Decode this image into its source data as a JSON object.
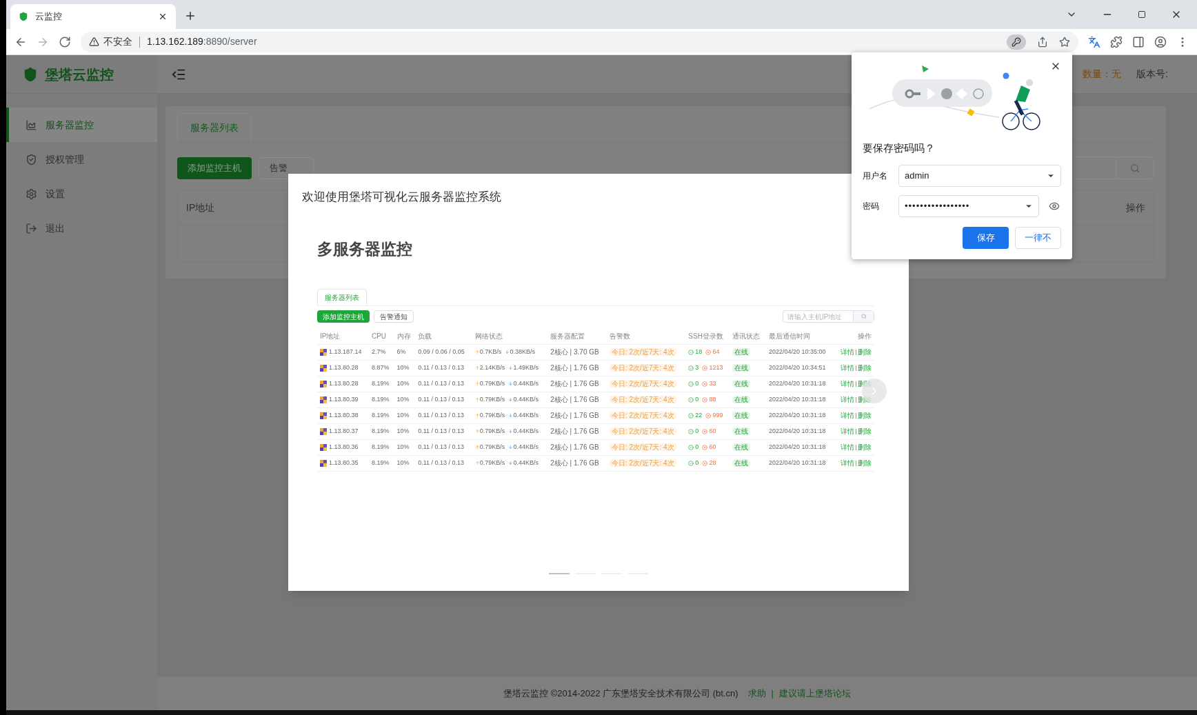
{
  "browser": {
    "tab": {
      "title": "云监控"
    },
    "address": {
      "security": "不安全",
      "host": "1.13.162.189",
      "path": ":8890/server"
    }
  },
  "app": {
    "logo": "堡塔云监控",
    "header_info": [
      {
        "text": "数量：无"
      },
      {
        "text": "版本号:"
      }
    ],
    "sidebar": [
      {
        "label": "服务器监控",
        "selected": true
      },
      {
        "label": "授权管理",
        "selected": false
      },
      {
        "label": "设置",
        "selected": false
      },
      {
        "label": "退出",
        "selected": false
      }
    ],
    "tabs": [
      {
        "label": "服务器列表",
        "selected": true
      }
    ],
    "buttons": [
      {
        "label": "添加监控主机",
        "kind": "primary"
      },
      {
        "label": "告警",
        "kind": "default"
      }
    ],
    "table": {
      "columns": [
        "IP地址",
        "操作"
      ]
    },
    "footer": {
      "text": "堡塔云监控 ©2014-2022 广东堡塔安全技术有限公司 (bt.cn)",
      "links": [
        "求助",
        "建议请上堡塔论坛"
      ],
      "separator": "|"
    }
  },
  "modal": {
    "title": "欢迎使用堡塔可视化云服务器监控系统",
    "heading": "多服务器监控",
    "indicators": [
      {
        "selected": true
      },
      {
        "selected": false
      },
      {
        "selected": false
      },
      {
        "selected": false
      }
    ],
    "preview": {
      "tabs": [
        {
          "label": "服务器列表",
          "selected": true
        }
      ],
      "buttons": [
        {
          "label": "添加监控主机",
          "kind": "primary"
        },
        {
          "label": "告警通知",
          "kind": "default"
        }
      ],
      "search": {
        "placeholder": "请输入主机IP地址"
      },
      "columns": [
        "IP地址",
        "CPU",
        "内存",
        "负载",
        "网络状态",
        "服务器配置",
        "告警数",
        "SSH登录数",
        "通讯状态",
        "最后通信时间",
        "操作"
      ],
      "rows": [
        {
          "ip": "1.13.187.14",
          "cpu": "2.7%",
          "mem": "6%",
          "load": "0.09 / 0.06 / 0.05",
          "up": "0.7KB/s",
          "down": "0.38KB/s",
          "config": "2核心 | 3.70 GB",
          "alerts": "今日: 2次/近7天: 4次",
          "ssh_ok": "18",
          "ssh_fail": "64",
          "status": "在线",
          "time": "2022/04/20 10:35:00",
          "actions": [
            "详情",
            "删除"
          ]
        },
        {
          "ip": "1.13.80.28",
          "cpu": "8.87%",
          "mem": "10%",
          "load": "0.11 / 0.13 / 0.13",
          "up": "2.14KB/s",
          "down": "1.49KB/s",
          "config": "2核心 | 1.76 GB",
          "alerts": "今日: 2次/近7天: 4次",
          "ssh_ok": "3",
          "ssh_fail": "1213",
          "status": "在线",
          "time": "2022/04/20 10:34:51",
          "actions": [
            "详情",
            "删除"
          ]
        },
        {
          "ip": "1.13.80.28",
          "cpu": "8.19%",
          "mem": "10%",
          "load": "0.11 / 0.13 / 0.13",
          "up": "0.79KB/s",
          "down": "0.44KB/s",
          "config": "2核心 | 1.76 GB",
          "alerts": "今日: 2次/近7天: 4次",
          "ssh_ok": "0",
          "ssh_fail": "33",
          "status": "在线",
          "time": "2022/04/20 10:31:18",
          "actions": [
            "详情",
            "删除"
          ]
        },
        {
          "ip": "1.13.80.39",
          "cpu": "8.19%",
          "mem": "10%",
          "load": "0.11 / 0.13 / 0.13",
          "up": "0.79KB/s",
          "down": "0.44KB/s",
          "config": "2核心 | 1.76 GB",
          "alerts": "今日: 2次/近7天: 4次",
          "ssh_ok": "0",
          "ssh_fail": "88",
          "status": "在线",
          "time": "2022/04/20 10:31:18",
          "actions": [
            "详情",
            "删除"
          ]
        },
        {
          "ip": "1.13.80.38",
          "cpu": "8.19%",
          "mem": "10%",
          "load": "0.11 / 0.13 / 0.13",
          "up": "0.79KB/s",
          "down": "0.44KB/s",
          "config": "2核心 | 1.76 GB",
          "alerts": "今日: 2次/近7天: 4次",
          "ssh_ok": "22",
          "ssh_fail": "999",
          "status": "在线",
          "time": "2022/04/20 10:31:18",
          "actions": [
            "详情",
            "删除"
          ]
        },
        {
          "ip": "1.13.80.37",
          "cpu": "8.19%",
          "mem": "10%",
          "load": "0.11 / 0.13 / 0.13",
          "up": "0.79KB/s",
          "down": "0.44KB/s",
          "config": "2核心 | 1.76 GB",
          "alerts": "今日: 2次/近7天: 4次",
          "ssh_ok": "0",
          "ssh_fail": "60",
          "status": "在线",
          "time": "2022/04/20 10:31:18",
          "actions": [
            "详情",
            "删除"
          ]
        },
        {
          "ip": "1.13.80.36",
          "cpu": "8.19%",
          "mem": "10%",
          "load": "0.11 / 0.13 / 0.13",
          "up": "0.79KB/s",
          "down": "0.44KB/s",
          "config": "2核心 | 1.76 GB",
          "alerts": "今日: 2次/近7天: 4次",
          "ssh_ok": "0",
          "ssh_fail": "60",
          "status": "在线",
          "time": "2022/04/20 10:31:18",
          "actions": [
            "详情",
            "删除"
          ]
        },
        {
          "ip": "1.13.80.35",
          "cpu": "8.19%",
          "mem": "10%",
          "load": "0.11 / 0.13 / 0.13",
          "up": "0.79KB/s",
          "down": "0.44KB/s",
          "config": "2核心 | 1.76 GB",
          "alerts": "今日: 2次/近7天: 4次",
          "ssh_ok": "0",
          "ssh_fail": "28",
          "status": "在线",
          "time": "2022/04/20 10:31:18",
          "actions": [
            "详情",
            "删除"
          ]
        }
      ]
    }
  },
  "password_popup": {
    "title": "要保存密码吗？",
    "fields": [
      {
        "label": "用户名",
        "value": "admin",
        "kind": "text"
      },
      {
        "label": "密码",
        "value": "•••••••••••••••••",
        "kind": "password"
      }
    ],
    "buttons": [
      {
        "label": "保存",
        "kind": "primary"
      },
      {
        "label": "一律不",
        "kind": "secondary"
      }
    ]
  }
}
